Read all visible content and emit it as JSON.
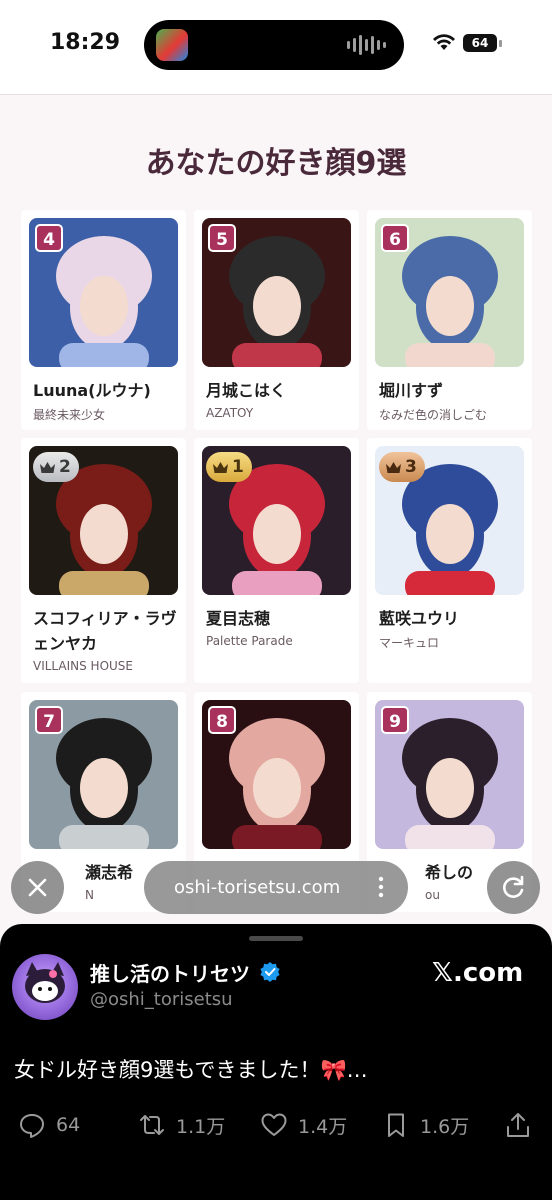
{
  "status_bar": {
    "time": "18:29",
    "battery": "64"
  },
  "page": {
    "title": "あなたの好き顔9選"
  },
  "cards": [
    {
      "rank": "4",
      "crown": "",
      "name": "Luuna(ルウナ)",
      "group": "最終未来少女",
      "photo": [
        "#3c5fa8",
        "#9fb6e6",
        "#e9d6e6"
      ]
    },
    {
      "rank": "5",
      "crown": "",
      "name": "月城こはく",
      "group": "AZATOY",
      "photo": [
        "#3a1515",
        "#c0374a",
        "#2b2b2b"
      ]
    },
    {
      "rank": "6",
      "crown": "",
      "name": "堀川すず",
      "group": "なみだ色の消しごむ",
      "photo": [
        "#cfe0c6",
        "#f2d7cf",
        "#4a6aa8"
      ]
    },
    {
      "rank": "2",
      "crown": "silver",
      "name": "スコフィリア・ラヴェンヤカ",
      "group": "VILLAINS HOUSE",
      "photo": [
        "#1f1a14",
        "#c9a86a",
        "#7a1d18"
      ]
    },
    {
      "rank": "1",
      "crown": "gold",
      "name": "夏目志穂",
      "group": "Palette Parade",
      "photo": [
        "#2a1e2a",
        "#e9a0c0",
        "#c7263a"
      ]
    },
    {
      "rank": "3",
      "crown": "bronze",
      "name": "藍咲ユウリ",
      "group": "マーキュロ",
      "photo": [
        "#e7eef7",
        "#d62a3a",
        "#2f4c9a"
      ]
    },
    {
      "rank": "7",
      "crown": "",
      "name": "",
      "group": "",
      "photo": [
        "#8c9aa3",
        "#c9cfd1",
        "#1c1c1c"
      ]
    },
    {
      "rank": "8",
      "crown": "",
      "name": "",
      "group": "",
      "photo": [
        "#2a0f12",
        "#7a1a24",
        "#e3a9a0"
      ]
    },
    {
      "rank": "9",
      "crown": "",
      "name": "",
      "group": "",
      "photo": [
        "#c4b8de",
        "#f1e2ea",
        "#2a1f2a"
      ]
    }
  ],
  "row3_partial": {
    "name_left": "瀬志希",
    "group_left": "N",
    "name_right": "希しの",
    "group_right": "ou"
  },
  "browser": {
    "url": "oshi-torisetsu.com"
  },
  "tweet": {
    "display_name": "推し活のトリセツ",
    "username": "@oshi_torisetsu",
    "source": "𝕏.com",
    "text": "女ドル好き顔9選もできました！🎀…",
    "replies": "64",
    "retweets": "1.1万",
    "likes": "1.4万",
    "bookmarks": "1.6万"
  }
}
